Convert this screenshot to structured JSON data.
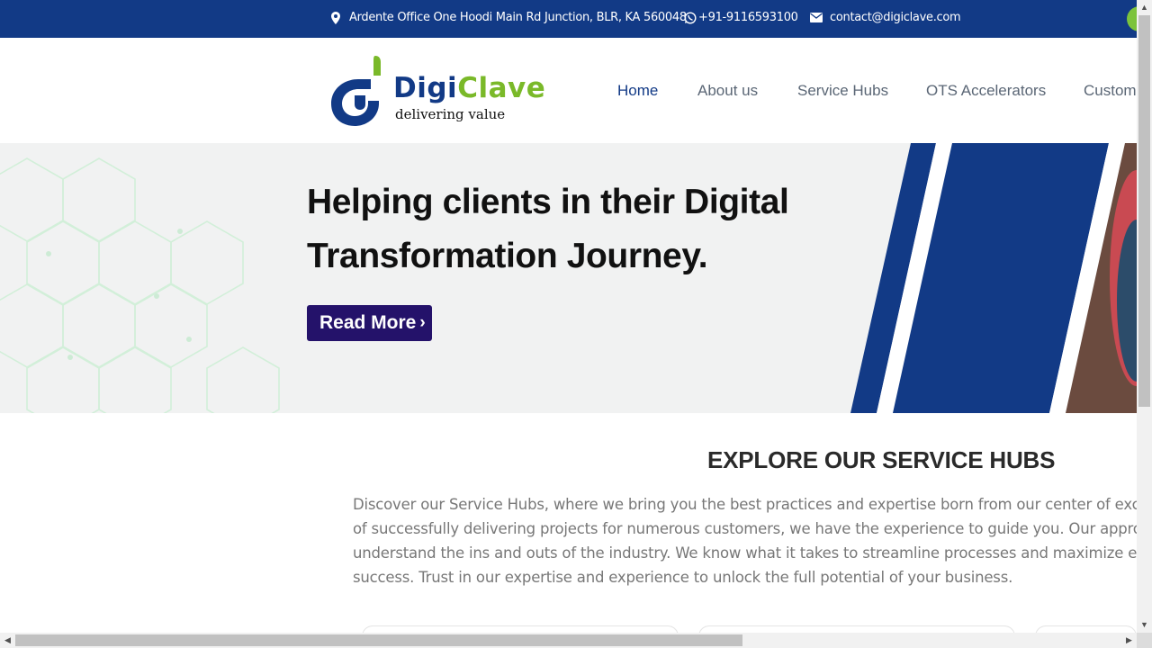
{
  "topbar": {
    "address": "Ardente Office One Hoodi Main Rd Junction, BLR, KA 560048",
    "phone": "+91-9116593100",
    "email": "contact@digiclave.com",
    "icons": [
      "map-pin-icon",
      "whatsapp-icon",
      "envelope-icon"
    ],
    "background": "#123a86"
  },
  "logo": {
    "name_part1": "Digi",
    "name_part2": "Clave",
    "tagline": "delivering value",
    "colors": {
      "navy": "#123a86",
      "green": "#7ab929"
    }
  },
  "nav": {
    "items": [
      "Home",
      "About us",
      "Service Hubs",
      "OTS Accelerators",
      "Custom"
    ],
    "active": "Home"
  },
  "hero": {
    "title": "Helping clients in their Digital Transformation Journey.",
    "button_label": "Read More",
    "button_color": "#24126a"
  },
  "section": {
    "title": "EXPLORE OUR SERVICE HUBS",
    "lines": [
      "Discover our Service Hubs, where we bring you the best practices and expertise born from our center of excelle",
      "of successfully delivering projects for numerous customers, we have the experience to guide you. Our approa",
      "understand the ins and outs of the industry. We know what it takes to streamline processes and maximize eff",
      "success. Trust in our expertise and experience to unlock the full potential of your business."
    ]
  }
}
